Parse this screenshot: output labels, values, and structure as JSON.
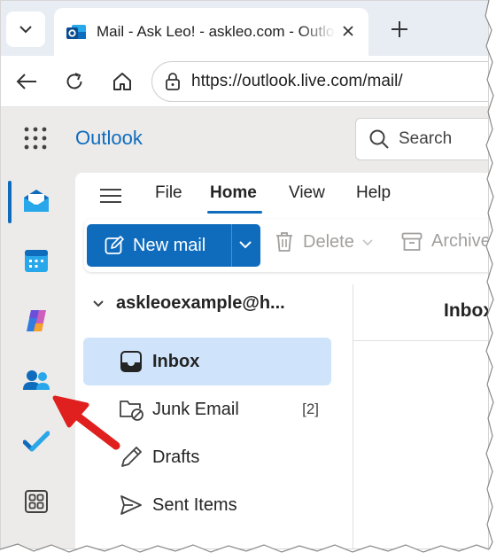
{
  "browser": {
    "tab_title": "Mail - Ask Leo! - askleo.com - Outlook",
    "url": "https://outlook.live.com/mail/"
  },
  "app": {
    "brand": "Outlook",
    "search_placeholder": "Search",
    "menu": [
      "File",
      "Home",
      "View",
      "Help"
    ],
    "active_menu": "Home",
    "ribbon": {
      "new_mail": "New mail",
      "delete": "Delete",
      "archive": "Archive"
    },
    "account": "askleoexample@h...",
    "folders": [
      {
        "label": "Inbox",
        "count": "",
        "icon": "inbox-icon",
        "selected": true
      },
      {
        "label": "Junk Email",
        "count": "[2]",
        "icon": "junk-icon",
        "selected": false
      },
      {
        "label": "Drafts",
        "count": "",
        "icon": "drafts-icon",
        "selected": false
      },
      {
        "label": "Sent Items",
        "count": "",
        "icon": "sent-icon",
        "selected": false
      }
    ],
    "list_title": "Inbox"
  },
  "rail": [
    "mail-icon",
    "calendar-icon",
    "copilot-icon",
    "people-icon",
    "todo-icon",
    "apps-icon"
  ],
  "colors": {
    "accent": "#0f6cbd",
    "selected_folder": "#cfe4fa",
    "annotation_arrow": "#e01f1f"
  }
}
